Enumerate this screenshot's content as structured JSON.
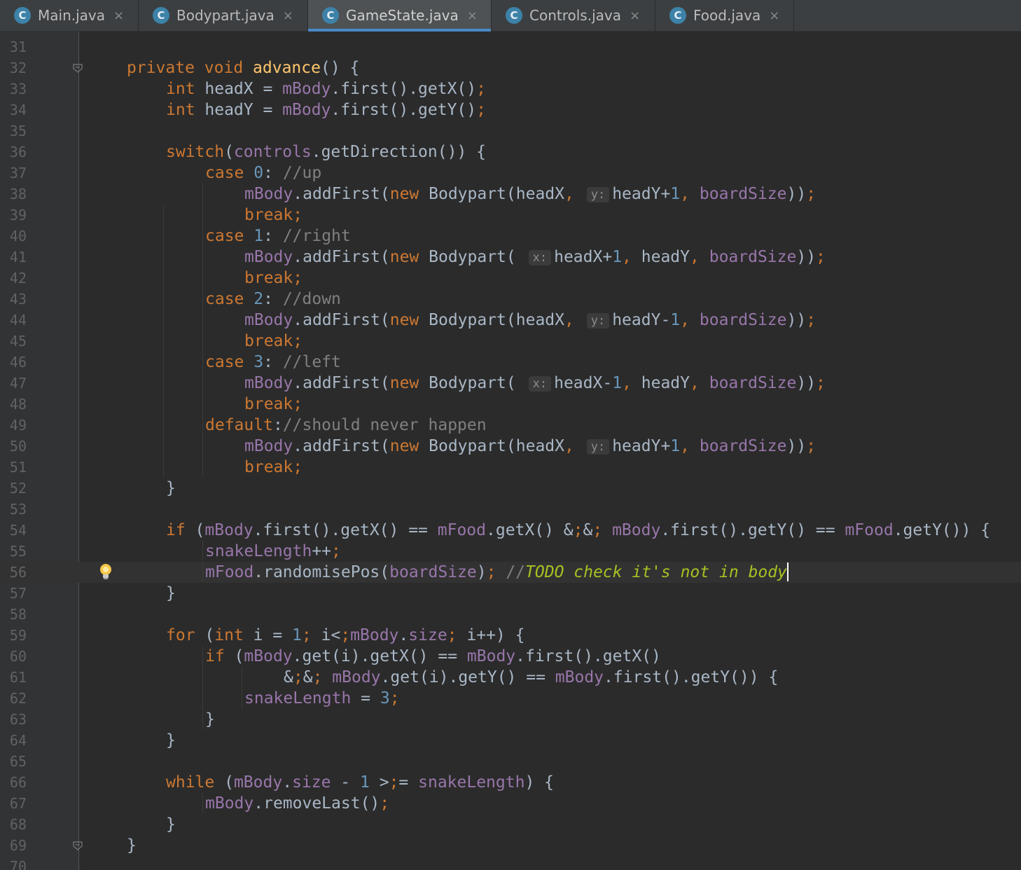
{
  "tabs": [
    {
      "label": "Main.java",
      "icon": "class-icon",
      "active": false
    },
    {
      "label": "Bodypart.java",
      "icon": "class-icon",
      "active": false
    },
    {
      "label": "GameState.java",
      "icon": "class-icon",
      "active": true
    },
    {
      "label": "Controls.java",
      "icon": "class-icon",
      "active": false
    },
    {
      "label": "Food.java",
      "icon": "class-icon",
      "active": false
    }
  ],
  "tab_icon_letter": "C",
  "tab_close_glyph": "×",
  "editor": {
    "current_line": 56,
    "lines": [
      {
        "n": "31",
        "code": ""
      },
      {
        "n": "32",
        "code": "private void advance() {"
      },
      {
        "n": "33",
        "code": "int headX = mBody.first().getX();"
      },
      {
        "n": "34",
        "code": "int headY = mBody.first().getY();"
      },
      {
        "n": "35",
        "code": ""
      },
      {
        "n": "36",
        "code": "switch(controls.getDirection()) {"
      },
      {
        "n": "37",
        "code": "case 0: //up"
      },
      {
        "n": "38",
        "code": "mBody.addFirst(new Bodypart(headX, y: headY+1, boardSize));"
      },
      {
        "n": "39",
        "code": "break;"
      },
      {
        "n": "40",
        "code": "case 1: //right"
      },
      {
        "n": "41",
        "code": "mBody.addFirst(new Bodypart( x: headX+1, headY, boardSize));"
      },
      {
        "n": "42",
        "code": "break;"
      },
      {
        "n": "43",
        "code": "case 2: //down"
      },
      {
        "n": "44",
        "code": "mBody.addFirst(new Bodypart(headX, y: headY-1, boardSize));"
      },
      {
        "n": "45",
        "code": "break;"
      },
      {
        "n": "46",
        "code": "case 3: //left"
      },
      {
        "n": "47",
        "code": "mBody.addFirst(new Bodypart( x: headX-1, headY, boardSize));"
      },
      {
        "n": "48",
        "code": "break;"
      },
      {
        "n": "49",
        "code": "default://should never happen"
      },
      {
        "n": "50",
        "code": "mBody.addFirst(new Bodypart(headX, y: headY+1, boardSize));"
      },
      {
        "n": "51",
        "code": "break;"
      },
      {
        "n": "52",
        "code": "}"
      },
      {
        "n": "53",
        "code": ""
      },
      {
        "n": "54",
        "code": "if (mBody.first().getX() == mFood.getX() && mBody.first().getY() == mFood.getY()) {"
      },
      {
        "n": "55",
        "code": "snakeLength++;"
      },
      {
        "n": "56",
        "code": "mFood.randomisePos(boardSize); //TODO check it's not in body"
      },
      {
        "n": "57",
        "code": "}"
      },
      {
        "n": "58",
        "code": ""
      },
      {
        "n": "59",
        "code": "for (int i = 1; i<mBody.size; i++) {"
      },
      {
        "n": "60",
        "code": "if (mBody.get(i).getX() == mBody.first().getX()"
      },
      {
        "n": "61",
        "code": "&& mBody.get(i).getY() == mBody.first().getY()) {"
      },
      {
        "n": "62",
        "code": "snakeLength = 3;"
      },
      {
        "n": "63",
        "code": "}"
      },
      {
        "n": "64",
        "code": "}"
      },
      {
        "n": "65",
        "code": ""
      },
      {
        "n": "66",
        "code": "while (mBody.size - 1 >= snakeLength) {"
      },
      {
        "n": "67",
        "code": "mBody.removeLast();"
      },
      {
        "n": "68",
        "code": "}"
      },
      {
        "n": "69",
        "code": "}"
      },
      {
        "n": "70",
        "code": ""
      }
    ]
  },
  "colors": {
    "background": "#2b2b2b",
    "gutter": "#313335",
    "keyword": "#cc7832",
    "method_decl": "#ffc66d",
    "field": "#9876aa",
    "number": "#6897bb",
    "comment": "#808080",
    "todo": "#a8c023",
    "text": "#a9b7c6",
    "tab_accent": "#4a88c7"
  },
  "icons": {
    "fold": "fold-icon",
    "intention": "lightbulb-icon"
  }
}
